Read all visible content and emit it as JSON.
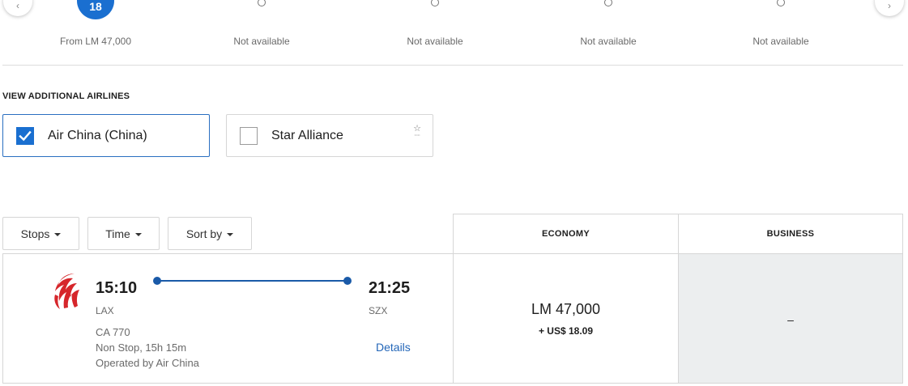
{
  "date_strip": {
    "selected_day": "18",
    "days": [
      {
        "label": "From LM 47,000",
        "selected": true
      },
      {
        "label": "Not available",
        "selected": false
      },
      {
        "label": "Not available",
        "selected": false
      },
      {
        "label": "Not available",
        "selected": false
      },
      {
        "label": "Not available",
        "selected": false
      }
    ]
  },
  "additional_airlines": {
    "title": "VIEW ADDITIONAL AIRLINES",
    "options": [
      {
        "name": "Air China (China)",
        "checked": true
      },
      {
        "name": "Star Alliance",
        "checked": false
      }
    ]
  },
  "filters": {
    "stops": "Stops",
    "time": "Time",
    "sort": "Sort by"
  },
  "cabins": {
    "economy": "ECONOMY",
    "business": "BUSINESS"
  },
  "flight": {
    "depart_time": "15:10",
    "depart_airport": "LAX",
    "arrive_time": "21:25",
    "arrive_airport": "SZX",
    "flight_number": "CA 770",
    "duration": "Non Stop, 15h 15m",
    "operated_by": "Operated by Air China",
    "details_label": "Details",
    "economy_price": "LM 47,000",
    "economy_tax": "+ US$ 18.09",
    "business_price": "–"
  },
  "colors": {
    "accent": "#1a6fd0",
    "route": "#1a5aa8",
    "logo_red": "#d6262b",
    "business_bg": "#eceeef"
  },
  "icons": {
    "nav_prev": "chevron-left-icon",
    "nav_next": "chevron-right-icon",
    "checkbox": "checkmark-icon",
    "alliance": "star-alliance-icon",
    "airline_logo": "air-china-logo",
    "dropdown": "caret-down-icon"
  }
}
